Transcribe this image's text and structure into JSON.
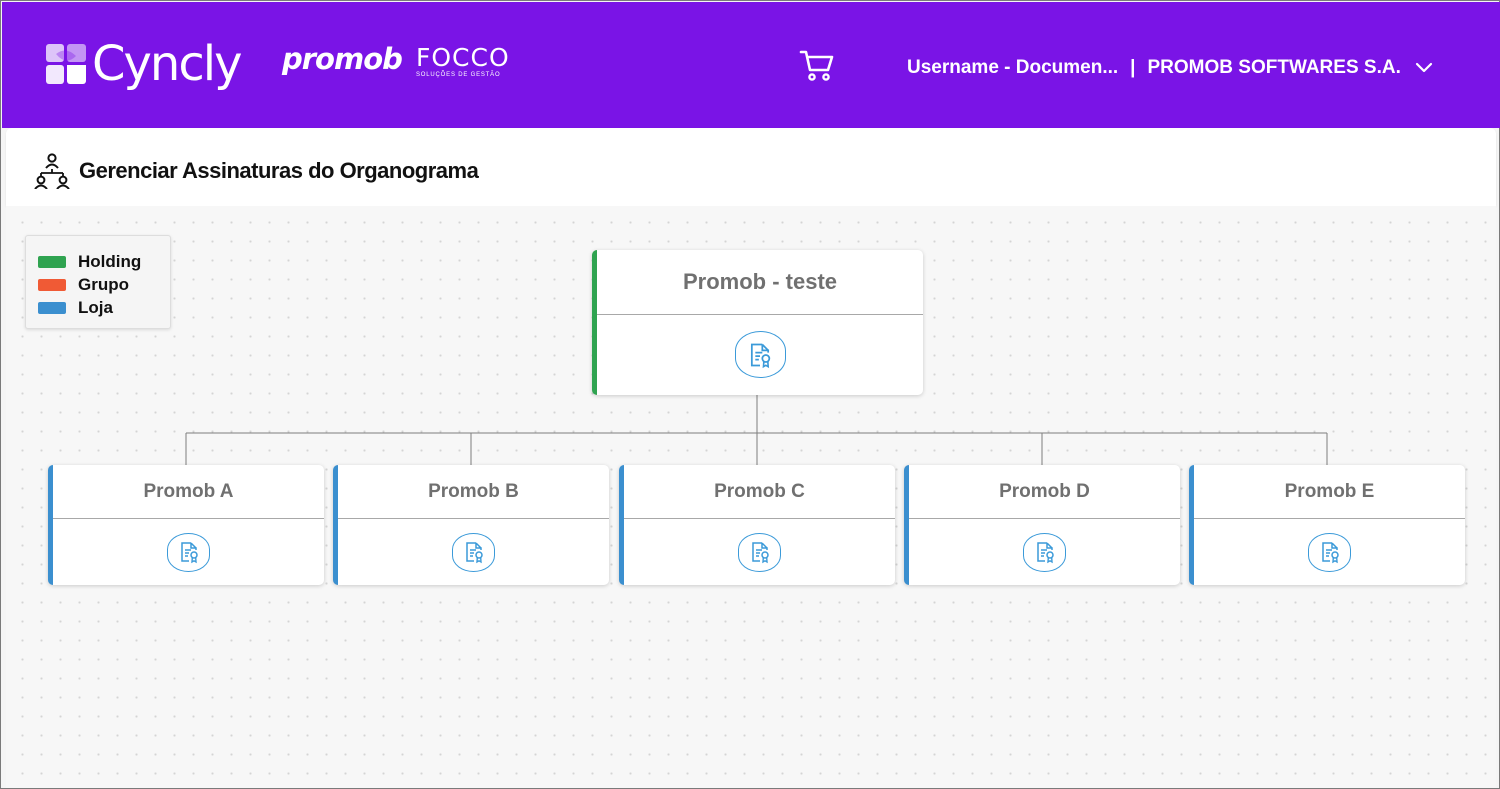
{
  "header": {
    "brand_cyncly": "Cyncly",
    "brand_promob": "promob",
    "brand_focco": "FOCCO",
    "brand_focco_tagline": "SOLUÇÕES DE GESTÃO",
    "username": "Username - Documen...",
    "separator": "|",
    "company": "PROMOB SOFTWARES S.A.",
    "cart_icon": "cart-icon",
    "dropdown_icon": "chevron-down-icon",
    "background_color": "#7a14e6"
  },
  "page": {
    "title": "Gerenciar Assinaturas do Organograma",
    "title_icon": "org-chart-icon"
  },
  "legend": {
    "items": [
      {
        "label": "Holding",
        "color": "#2fa350"
      },
      {
        "label": "Grupo",
        "color": "#f05a35"
      },
      {
        "label": "Loja",
        "color": "#3b8fcf"
      }
    ]
  },
  "org": {
    "root": {
      "name": "Promob - teste",
      "type": "Holding",
      "action_icon": "signature-document-icon"
    },
    "children": [
      {
        "name": "Promob A",
        "type": "Loja",
        "action_icon": "signature-document-icon"
      },
      {
        "name": "Promob B",
        "type": "Loja",
        "action_icon": "signature-document-icon"
      },
      {
        "name": "Promob C",
        "type": "Loja",
        "action_icon": "signature-document-icon"
      },
      {
        "name": "Promob D",
        "type": "Loja",
        "action_icon": "signature-document-icon"
      },
      {
        "name": "Promob E",
        "type": "Loja",
        "action_icon": "signature-document-icon"
      }
    ]
  }
}
